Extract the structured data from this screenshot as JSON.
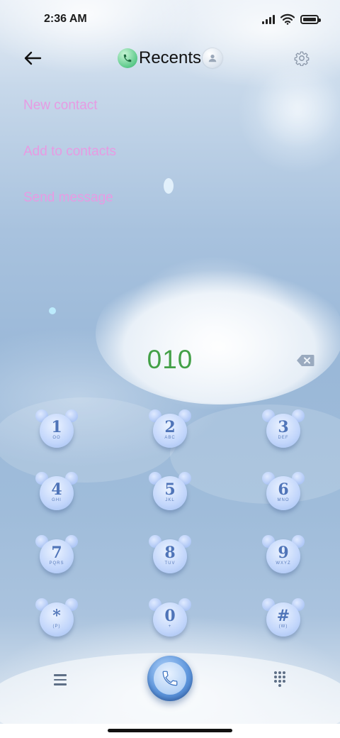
{
  "status_bar": {
    "time": "2:36 AM",
    "icons": [
      "signal-icon",
      "wifi-icon",
      "battery-icon"
    ]
  },
  "header": {
    "title": "Recents",
    "back_icon": "arrow-left-icon",
    "settings_icon": "gear-icon",
    "title_left_icon": "phone-icon",
    "title_right_icon": "contact-icon"
  },
  "menu": {
    "items": [
      {
        "label": "New contact"
      },
      {
        "label": "Add to contacts"
      },
      {
        "label": "Send message"
      }
    ]
  },
  "dialer": {
    "number": "010",
    "backspace_icon": "backspace-icon"
  },
  "keypad": {
    "keys": [
      {
        "digit": "1",
        "letters": "OO"
      },
      {
        "digit": "2",
        "letters": "ABC"
      },
      {
        "digit": "3",
        "letters": "DEF"
      },
      {
        "digit": "4",
        "letters": "GHI"
      },
      {
        "digit": "5",
        "letters": "JKL"
      },
      {
        "digit": "6",
        "letters": "MNO"
      },
      {
        "digit": "7",
        "letters": "PQRS"
      },
      {
        "digit": "8",
        "letters": "TUV"
      },
      {
        "digit": "9",
        "letters": "WXYZ"
      },
      {
        "digit": "*",
        "letters": "(P)"
      },
      {
        "digit": "0",
        "letters": "+"
      },
      {
        "digit": "#",
        "letters": "(W)"
      }
    ]
  },
  "bottom_bar": {
    "menu_icon": "hamburger-menu-icon",
    "call_icon": "phone-call-icon",
    "dialpad_icon": "dialpad-icon"
  },
  "colors": {
    "menu_text": "#e79be3",
    "number_text": "#43a047",
    "key_digit": "#4f74b8",
    "background_top": "#e7eef6",
    "background_mid": "#9ab8d8"
  }
}
